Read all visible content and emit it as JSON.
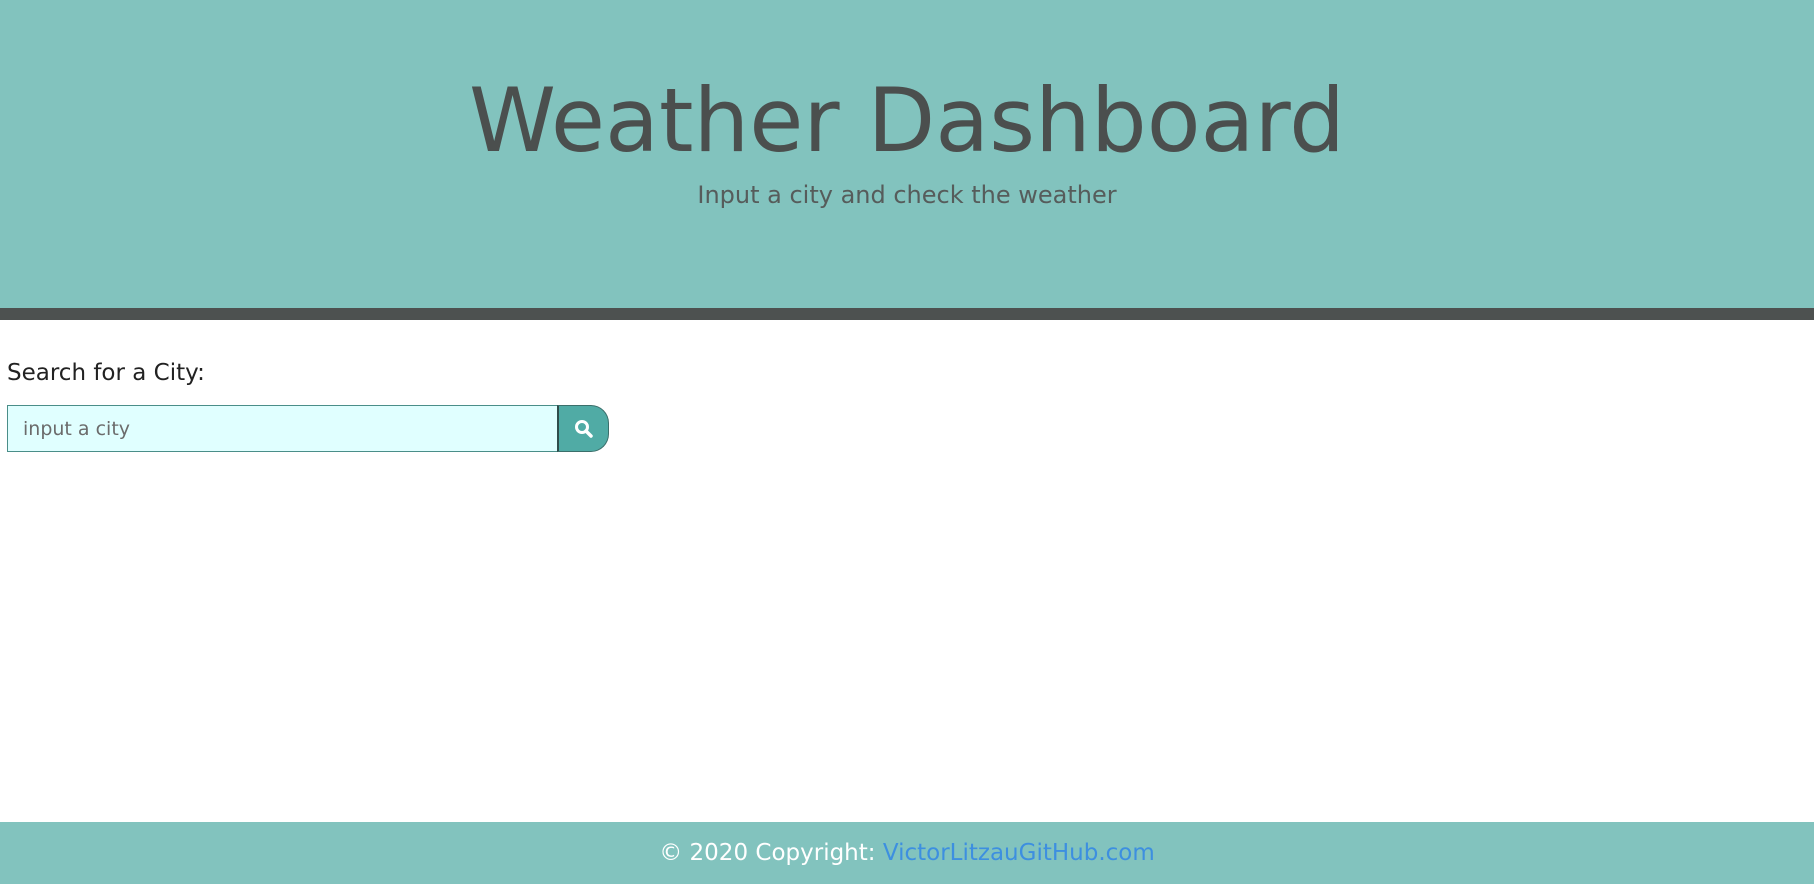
{
  "header": {
    "title": "Weather Dashboard",
    "subtitle": "Input a city and check the weather"
  },
  "search": {
    "label": "Search for a City:",
    "placeholder": "input a city",
    "value": "",
    "button_icon": "search-icon"
  },
  "footer": {
    "copyright_text": "© 2020 Copyright: ",
    "link_text": "VictorLitzauGitHub.com"
  },
  "colors": {
    "header_bg": "#82c3be",
    "header_bar": "#4d5150",
    "input_bg": "#e0ffff",
    "button_bg": "#50aba5",
    "link": "#3d8fe0"
  }
}
